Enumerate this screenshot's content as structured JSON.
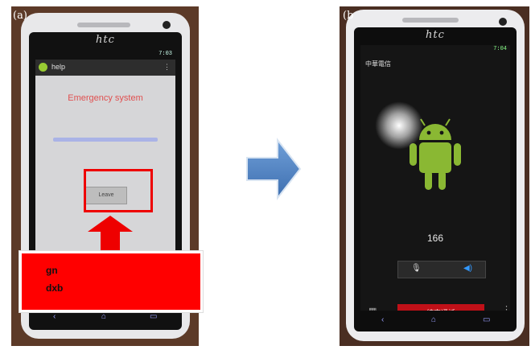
{
  "panel_a": {
    "label": "(a)",
    "phone_brand": "htc",
    "status_time": "7:03",
    "app_title": "help",
    "menu_glyph": "⋮",
    "screen_title": "Emergency system",
    "button_label": "Leave",
    "nav_icons": [
      "back-icon",
      "home-icon",
      "recent-apps-icon"
    ],
    "nav_glyphs": [
      "‹",
      "⌂",
      "▭"
    ],
    "callout_lines": [
      "gn",
      "dxb"
    ]
  },
  "panel_b": {
    "label": "(b",
    "phone_brand": "htc",
    "status_time": "7:04",
    "carrier": "中華電信",
    "caller_number": "166",
    "end_call_label": "結束通話",
    "mic_glyph": "🎙",
    "speaker_glyph": "◀)",
    "keypad_glyph": "▦",
    "more_glyph": "⋮",
    "nav_icons": [
      "back-icon",
      "home-icon",
      "recent-apps-icon"
    ],
    "nav_glyphs": [
      "‹",
      "⌂",
      "▭"
    ]
  },
  "colors": {
    "highlight_red": "#ff0000",
    "arrow_blue": "#4f81bd",
    "end_call_red": "#c01018",
    "android_green": "#8ab833"
  }
}
